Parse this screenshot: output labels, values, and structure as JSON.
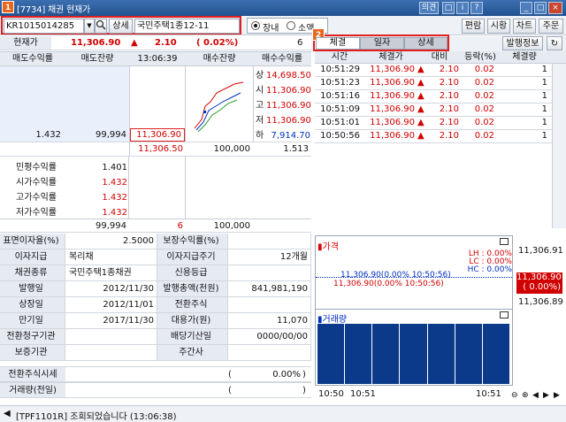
{
  "window": {
    "title": "[7734] 채권 현재가",
    "marker1": "1",
    "marker2": "2",
    "buttons": [
      "의견",
      "□",
      "i",
      "?",
      "_",
      "□",
      "×"
    ]
  },
  "controls": {
    "code": "KR1015014285",
    "search_icon": "magnifier-icon",
    "detail_label": "상세",
    "name": "국민주택1종12-11",
    "radio1": "장내",
    "radio2": "소액",
    "top_buttons": [
      "편람",
      "시황",
      "차트",
      "주문"
    ]
  },
  "price": {
    "label": "현재가",
    "value": "11,306.90",
    "arrow": "▲",
    "change": "2.10",
    "pct": "( 0.02%)",
    "count": "6",
    "sale_info": "발행정보"
  },
  "book": {
    "headers": [
      "매도수익률",
      "매도잔량",
      "13:06:39",
      "매수잔량",
      "매수수익률"
    ],
    "sell_yield": "1.432",
    "sell_qty": "99,994",
    "sell_price": "11,306.90",
    "buy_price": "11,306.50",
    "buy_qty": "100,000",
    "buy_yield": "1.513",
    "side_labels": [
      "상",
      "시",
      "고",
      "저",
      "하"
    ],
    "side_values": [
      "14,698.50",
      "11,306.90",
      "11,306.90",
      "11,306.90",
      "7,914.70"
    ],
    "yield_labels": [
      "민평수익률",
      "시가수익률",
      "고가수익률",
      "저가수익률"
    ],
    "yield_values": [
      "1.401",
      "1.432",
      "1.432",
      "1.432"
    ],
    "total_sell": "99,994",
    "total_count": "6",
    "total_buy": "100,000"
  },
  "info": {
    "rows": [
      [
        "표면이자율(%)",
        "2.5000",
        "보장수익률(%)",
        ""
      ],
      [
        "이자지급",
        "복리채",
        "이자지급주기",
        "12개월"
      ],
      [
        "채권종류",
        "국민주택1종채권",
        "신용등급",
        ""
      ],
      [
        "발행일",
        "2012/11/30",
        "발행총액(천원)",
        "841,981,190"
      ],
      [
        "상장일",
        "2012/11/01",
        "전환주식",
        ""
      ],
      [
        "만기일",
        "2017/11/30",
        "대용가(원)",
        "11,070"
      ],
      [
        "전환청구기관",
        "",
        "배당기산일",
        "0000/00/00"
      ],
      [
        "보증기관",
        "",
        "주간사",
        ""
      ]
    ],
    "conv_label": "전환주식시세",
    "conv_paren_open": "(",
    "conv_pct": "0.00%",
    "conv_paren_close": ")",
    "vol_label": "거래량(전일)",
    "vol_paren_open": "(",
    "vol_paren_close": ")"
  },
  "trades": {
    "tabs": [
      "체결",
      "일자",
      "상세"
    ],
    "headers": [
      "시간",
      "체결가",
      "대비",
      "등락(%)",
      "체결량"
    ],
    "rows": [
      [
        "10:51:29",
        "11,306.90",
        "2.10",
        "0.02",
        "1"
      ],
      [
        "10:51:23",
        "11,306.90",
        "2.10",
        "0.02",
        "1"
      ],
      [
        "10:51:16",
        "11,306.90",
        "2.10",
        "0.02",
        "1"
      ],
      [
        "10:51:09",
        "11,306.90",
        "2.10",
        "0.02",
        "1"
      ],
      [
        "10:51:01",
        "11,306.90",
        "2.10",
        "0.02",
        "1"
      ],
      [
        "10:50:56",
        "11,306.90",
        "2.10",
        "0.02",
        "1"
      ]
    ]
  },
  "chart": {
    "price_title": "가격",
    "volume_title": "거래량",
    "lh": "LH : 0.00%",
    "lc": "LC : 0.00%",
    "hc": "HC : 0.00%",
    "line1": "11,306.90(0.00% 10:50:56)",
    "line2": "11,306.90(0.00% 10:50:56)",
    "axis_top": "11,306.91",
    "axis_cur": "11,306.90",
    "axis_cur_pct": "( 0.00%)",
    "axis_bot": "11,306.89",
    "x_labels": [
      "10:50",
      "10:51",
      "10:51"
    ],
    "bars": [
      1,
      1,
      1,
      1,
      1,
      1,
      1
    ]
  },
  "status": {
    "message": "[TPF1101R] 조회되었습니다 (13:06:38)"
  }
}
